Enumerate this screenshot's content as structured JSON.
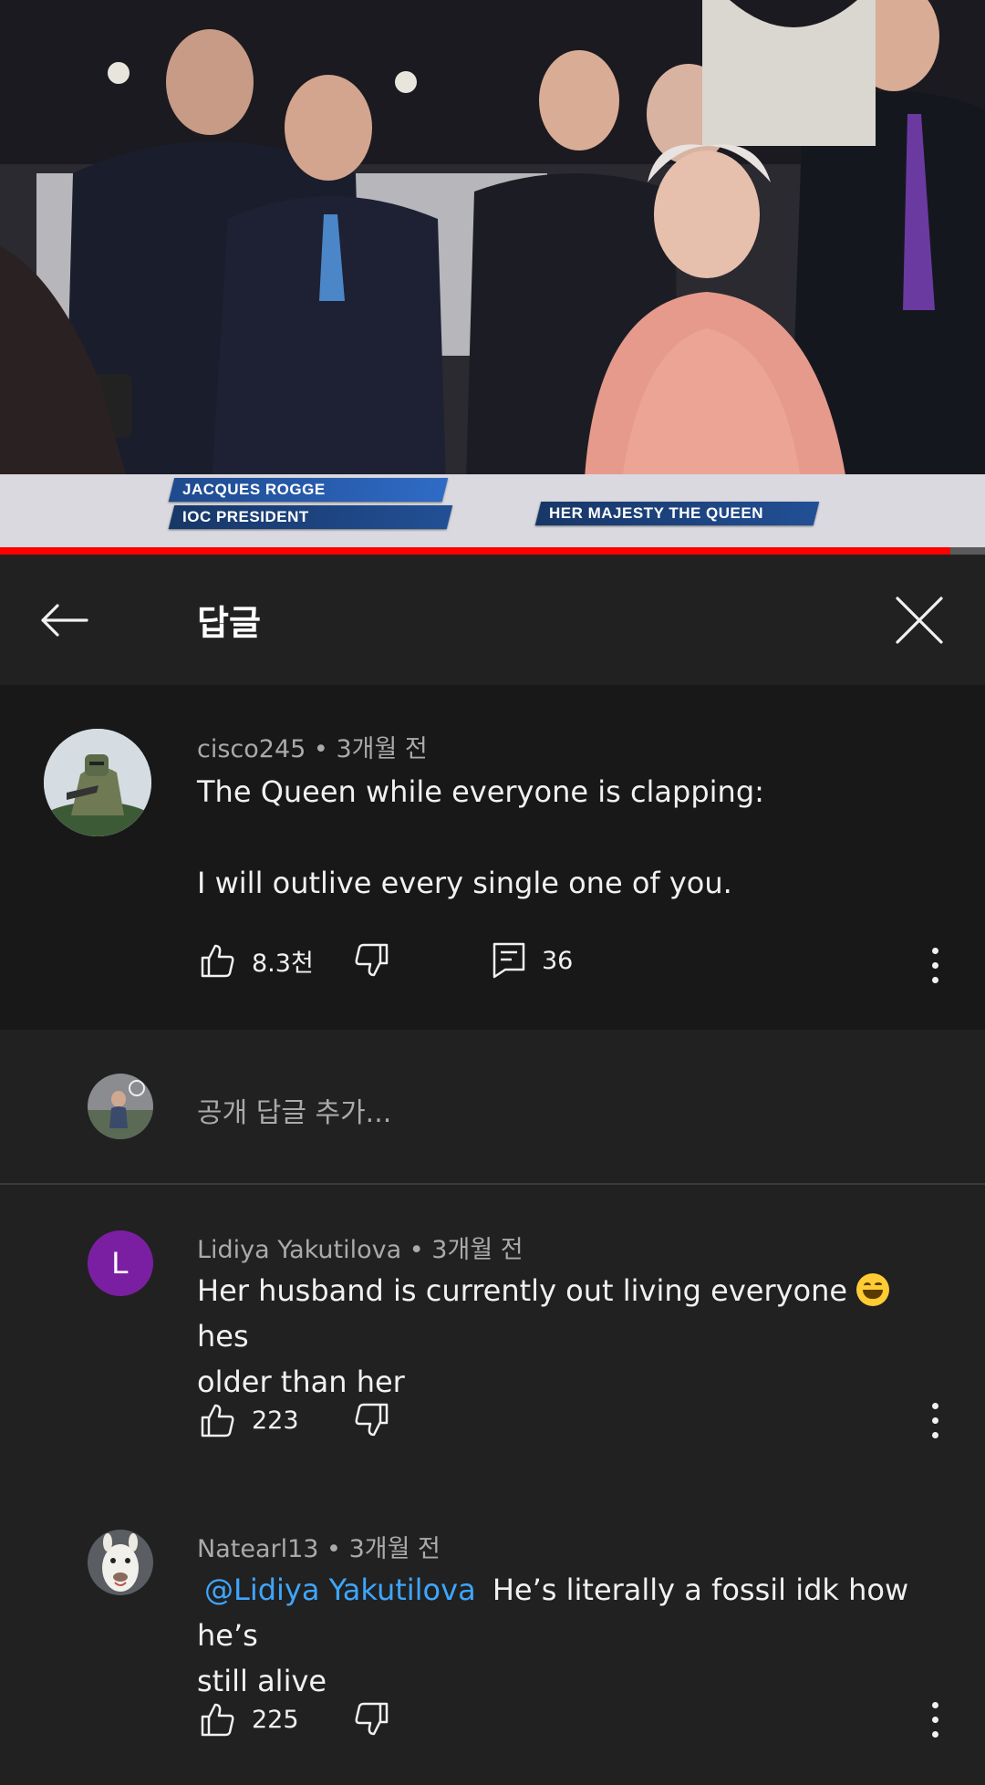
{
  "video": {
    "caption_left_name": "Jacques Rogge",
    "caption_left_title": "IOC President",
    "caption_right": "Her Majesty The Queen",
    "progress": 0.965,
    "progress_color": "#ff0000"
  },
  "header": {
    "title": "답글",
    "back_icon": "arrow-left-icon",
    "close_icon": "close-icon"
  },
  "main_comment": {
    "author": "cisco245",
    "separator": "•",
    "time": "3개월 전",
    "line1": "The Queen  while everyone is clapping:",
    "line2": "I will outlive every single one of you.",
    "likes": "8.3천",
    "replies": "36"
  },
  "add_reply": {
    "placeholder": "공개 답글 추가..."
  },
  "replies": [
    {
      "author": "Lidiya Yakutilova",
      "separator": "•",
      "time": "3개월 전",
      "avatar_letter": "L",
      "avatar_color": "#7b1fa2",
      "text_before_emoji": "Her husband is currently out living everyone ",
      "emoji": "😂",
      "text_after_emoji": " hes",
      "text_line2": "older than her",
      "likes": "223"
    },
    {
      "author": "Natearl13",
      "separator": "•",
      "time": "3개월 전",
      "mention": "@Lidiya Yakutilova",
      "text_after_mention": "He’s literally a fossil idk how he’s",
      "text_line2": "still alive",
      "likes": "225"
    }
  ]
}
